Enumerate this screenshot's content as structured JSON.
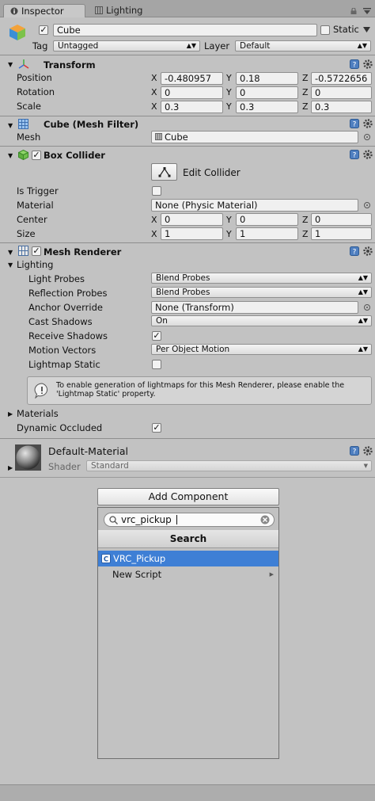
{
  "tabs": {
    "inspector": "Inspector",
    "lighting": "Lighting"
  },
  "object": {
    "name": "Cube",
    "static_label": "Static",
    "tag_label": "Tag",
    "tag_value": "Untagged",
    "layer_label": "Layer",
    "layer_value": "Default"
  },
  "transform": {
    "title": "Transform",
    "rows": [
      {
        "label": "Position",
        "x": "-0.480957",
        "y": "0.18",
        "z": "-0.5722656"
      },
      {
        "label": "Rotation",
        "x": "0",
        "y": "0",
        "z": "0"
      },
      {
        "label": "Scale",
        "x": "0.3",
        "y": "0.3",
        "z": "0.3"
      }
    ],
    "axis_x": "X",
    "axis_y": "Y",
    "axis_z": "Z"
  },
  "mesh_filter": {
    "title": "Cube (Mesh Filter)",
    "mesh_label": "Mesh",
    "mesh_value": "Cube"
  },
  "box_collider": {
    "title": "Box Collider",
    "edit_label": "Edit Collider",
    "is_trigger_label": "Is Trigger",
    "material_label": "Material",
    "material_value": "None (Physic Material)",
    "center_label": "Center",
    "center": {
      "x": "0",
      "y": "0",
      "z": "0"
    },
    "size_label": "Size",
    "size": {
      "x": "1",
      "y": "1",
      "z": "1"
    }
  },
  "mesh_renderer": {
    "title": "Mesh Renderer",
    "lighting_label": "Lighting",
    "light_probes_label": "Light Probes",
    "light_probes_value": "Blend Probes",
    "reflection_probes_label": "Reflection Probes",
    "reflection_probes_value": "Blend Probes",
    "anchor_override_label": "Anchor Override",
    "anchor_override_value": "None (Transform)",
    "cast_shadows_label": "Cast Shadows",
    "cast_shadows_value": "On",
    "receive_shadows_label": "Receive Shadows",
    "motion_vectors_label": "Motion Vectors",
    "motion_vectors_value": "Per Object Motion",
    "lightmap_static_label": "Lightmap Static",
    "info_text": "To enable generation of lightmaps for this Mesh Renderer, please enable the 'Lightmap Static' property.",
    "materials_label": "Materials",
    "dynamic_occluded_label": "Dynamic Occluded"
  },
  "material": {
    "name": "Default-Material",
    "shader_label": "Shader",
    "shader_value": "Standard"
  },
  "add_component": {
    "button_label": "Add Component",
    "search_value": "vrc_pickup",
    "popup_title": "Search",
    "results": [
      "VRC_Pickup",
      "New Script"
    ]
  },
  "colors": {
    "selection": "#3e7fd5",
    "panel": "#c2c2c2"
  }
}
